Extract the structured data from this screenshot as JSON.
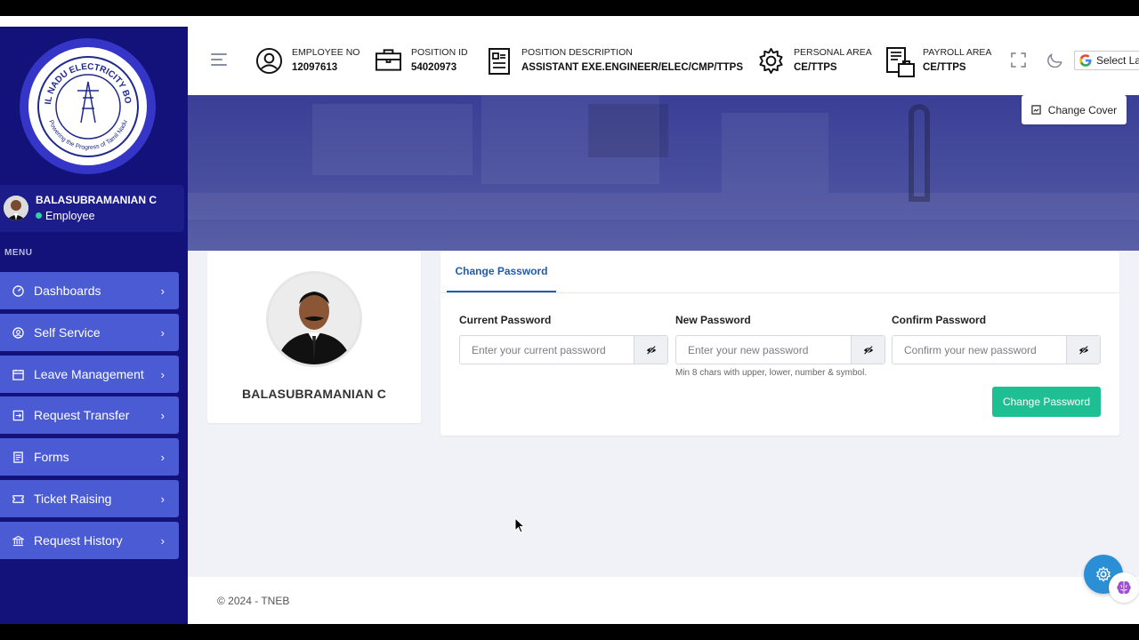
{
  "brand": {
    "logo_text_top": "TAMIL NADU ELECTRICITY BOARD",
    "logo_text_bottom": "Powering the Progress of Tamil Nadu"
  },
  "user": {
    "name": "BALASUBRAMANIAN C",
    "role": "Employee",
    "status_color": "#2ed3a4"
  },
  "sidebar": {
    "menu_label": "MENU",
    "items": [
      {
        "label": "Dashboards",
        "icon": "dashboard-icon"
      },
      {
        "label": "Self Service",
        "icon": "user-circle-icon"
      },
      {
        "label": "Leave Management",
        "icon": "calendar-icon"
      },
      {
        "label": "Request Transfer",
        "icon": "transfer-icon"
      },
      {
        "label": "Forms",
        "icon": "form-icon"
      },
      {
        "label": "Ticket Raising",
        "icon": "ticket-icon"
      },
      {
        "label": "Request History",
        "icon": "bank-icon"
      }
    ]
  },
  "header": {
    "employee_no_label": "EMPLOYEE NO",
    "employee_no": "12097613",
    "position_id_label": "POSITION ID",
    "position_id": "54020973",
    "position_desc_label": "POSITION DESCRIPTION",
    "position_desc": "ASSISTANT EXE.ENGINEER/ELEC/CMP/TTPS",
    "personal_area_label": "PERSONAL AREA",
    "personal_area": "CE/TTPS",
    "payroll_area_label": "PAYROLL AREA",
    "payroll_area": "CE/TTPS",
    "language_select": "Select La"
  },
  "cover": {
    "change_cover_label": "Change Cover"
  },
  "profile": {
    "name": "BALASUBRAMANIAN C"
  },
  "password": {
    "tab_label": "Change Password",
    "current_label": "Current Password",
    "current_placeholder": "Enter your current password",
    "new_label": "New Password",
    "new_placeholder": "Enter your new password",
    "new_hint": "Min 8 chars with upper, lower, number & symbol.",
    "confirm_label": "Confirm Password",
    "confirm_placeholder": "Confirm your new password",
    "submit_label": "Change Password"
  },
  "footer": {
    "text": "© 2024 - TNEB"
  },
  "colors": {
    "sidebar_bg": "#12127a",
    "nav_item_bg": "#4a5bd4",
    "accent_green": "#1fbf94",
    "tab_blue": "#1c5cb2",
    "fab_blue": "#2b8fd6"
  }
}
